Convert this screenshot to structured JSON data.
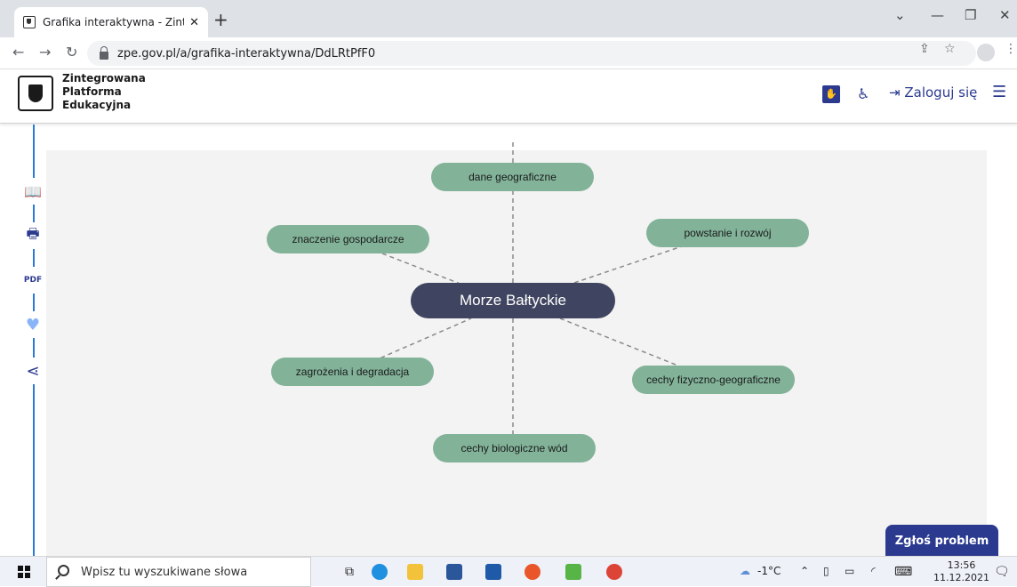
{
  "browser": {
    "tab_title": "Grafika interaktywna - Zintegrow",
    "tab_close": "✕",
    "new_tab": "+",
    "url": "zpe.gov.pl/a/grafika-interaktywna/DdLRtPfF0",
    "window_controls": [
      "⌄",
      "—",
      "❐",
      "✕"
    ]
  },
  "site": {
    "logo_lines": [
      "Zintegrowana",
      "Platforma",
      "Edukacyjna"
    ],
    "login_label": "Zaloguj się",
    "icons": [
      "sign-language-icon",
      "accessibility-icon",
      "login-icon",
      "menu-icon"
    ]
  },
  "rail": {
    "icons": [
      "book-icon",
      "print-icon",
      "pdf-icon",
      "heart-icon",
      "share-icon"
    ]
  },
  "mindmap": {
    "center": "Morze Bałtyckie",
    "nodes": [
      "dane geograficzne",
      "powstanie i rozwój",
      "znaczenie gospodarcze",
      "zagrożenia i degradacja",
      "cechy fizyczno-geograficzne",
      "cechy biologiczne wód"
    ],
    "colors": {
      "node": "#82b399",
      "center": "#3f4560",
      "edge": "#8a8a8a"
    }
  },
  "report_button": "Zgłoś problem",
  "taskbar": {
    "search_placeholder": "Wpisz tu wyszukiwane słowa",
    "weather": "-1°C",
    "time": "13:56",
    "date": "11.12.2021"
  }
}
